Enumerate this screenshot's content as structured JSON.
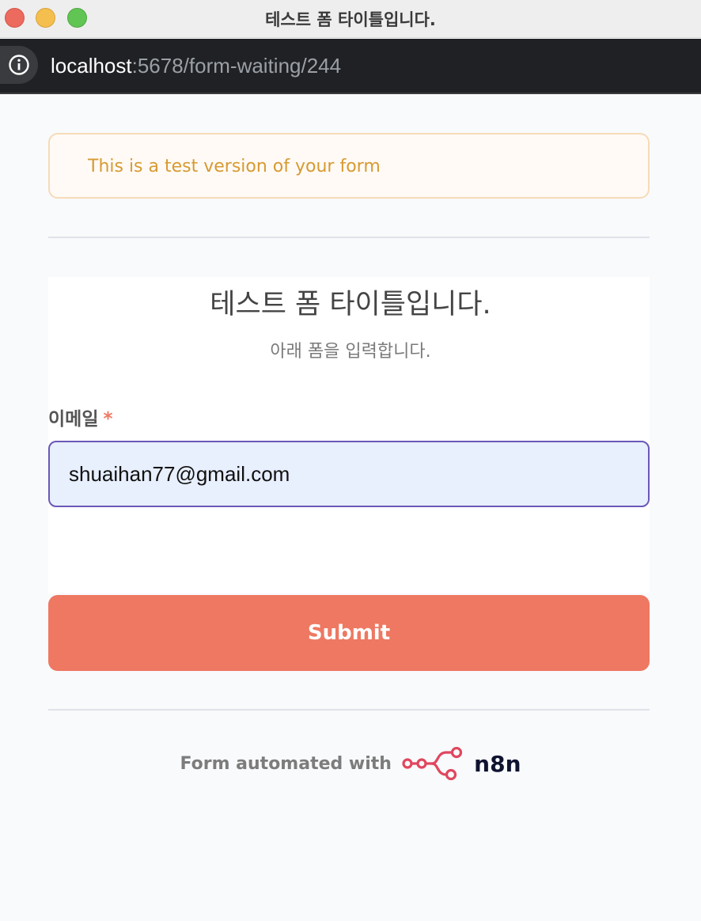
{
  "window": {
    "title": "테스트 폼 타이틀입니다."
  },
  "browser": {
    "url_host": "localhost",
    "url_rest": ":5678/form-waiting/244"
  },
  "banner": {
    "text": "This is a test version of your form"
  },
  "form": {
    "title": "테스트 폼 타이틀입니다.",
    "subtitle": "아래 폼을 입력합니다.",
    "fields": [
      {
        "label": "이메일",
        "required_mark": "*",
        "value": "shuaihan77@gmail.com"
      }
    ],
    "submit_label": "Submit"
  },
  "footer": {
    "text": "Form automated with",
    "brand": "n8n"
  },
  "colors": {
    "accent": "#ee7862",
    "banner_text": "#d79a32",
    "input_border": "#6b57b8",
    "logo": "#e0475f"
  }
}
